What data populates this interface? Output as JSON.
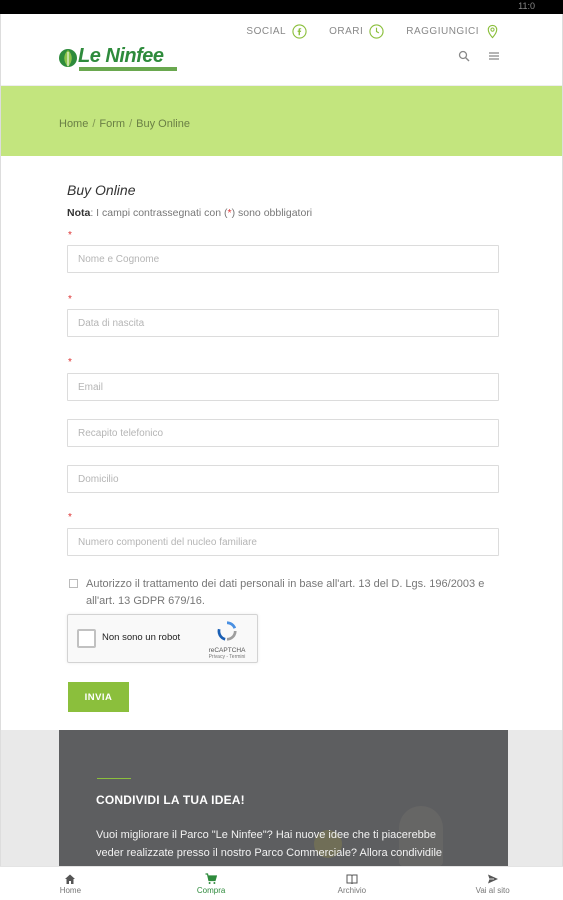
{
  "status_bar": {
    "time": "11:0"
  },
  "header": {
    "logo_text": "Le Ninfee",
    "top_nav": [
      {
        "label": "SOCIAL",
        "icon": "facebook-icon"
      },
      {
        "label": "ORARI",
        "icon": "clock-icon"
      },
      {
        "label": "RAGGIUNGICI",
        "icon": "map-pin-icon"
      }
    ],
    "tools": {
      "search_icon": "search-icon",
      "menu_icon": "hamburger-menu-icon"
    }
  },
  "breadcrumb": {
    "items": [
      "Home",
      "Form",
      "Buy Online"
    ],
    "separator": "/"
  },
  "form": {
    "title": "Buy Online",
    "note_label": "Nota",
    "note_text_before": ": I campi contrassegnati con (",
    "note_required_mark": "*",
    "note_text_after": ") sono obbligatori",
    "required_mark": "*",
    "fields": {
      "name": {
        "placeholder": "Nome e Cognome",
        "required": true
      },
      "birth": {
        "placeholder": "Data di nascita",
        "required": true
      },
      "email": {
        "placeholder": "Email",
        "required": true
      },
      "phone": {
        "placeholder": "Recapito telefonico",
        "required": false
      },
      "address": {
        "placeholder": "Domicilio",
        "required": false
      },
      "family": {
        "placeholder": "Numero componenti del nucleo familiare",
        "required": true
      }
    },
    "consent_text": "Autorizzo il trattamento dei dati personali in base all'art. 13 del D. Lgs. 196/2003 e all'art. 13 GDPR 679/16.",
    "recaptcha": {
      "label": "Non sono un robot",
      "brand": "reCAPTCHA",
      "terms": "Privacy - Termini"
    },
    "submit_label": "INVIA"
  },
  "idea_section": {
    "title": "CONDIVIDI LA TUA IDEA!",
    "body": "Vuoi migliorare il Parco \"Le Ninfee\"? Hai nuove idee che ti piacerebbe veder realizzate presso il nostro Parco Commerciale? Allora condividile insieme a"
  },
  "bottom_nav": {
    "tabs": [
      {
        "label": "Home",
        "icon": "home-icon",
        "active": false
      },
      {
        "label": "Compra",
        "icon": "cart-icon",
        "active": true
      },
      {
        "label": "Archivio",
        "icon": "book-icon",
        "active": false
      },
      {
        "label": "Vai al sito",
        "icon": "send-icon",
        "active": false
      }
    ]
  },
  "colors": {
    "brand_green": "#2e8b3c",
    "breadcrumb_band": "#c3e57e",
    "button_green": "#8bbf3c",
    "required_red": "#d33333",
    "idea_card": "#5d5e60"
  }
}
